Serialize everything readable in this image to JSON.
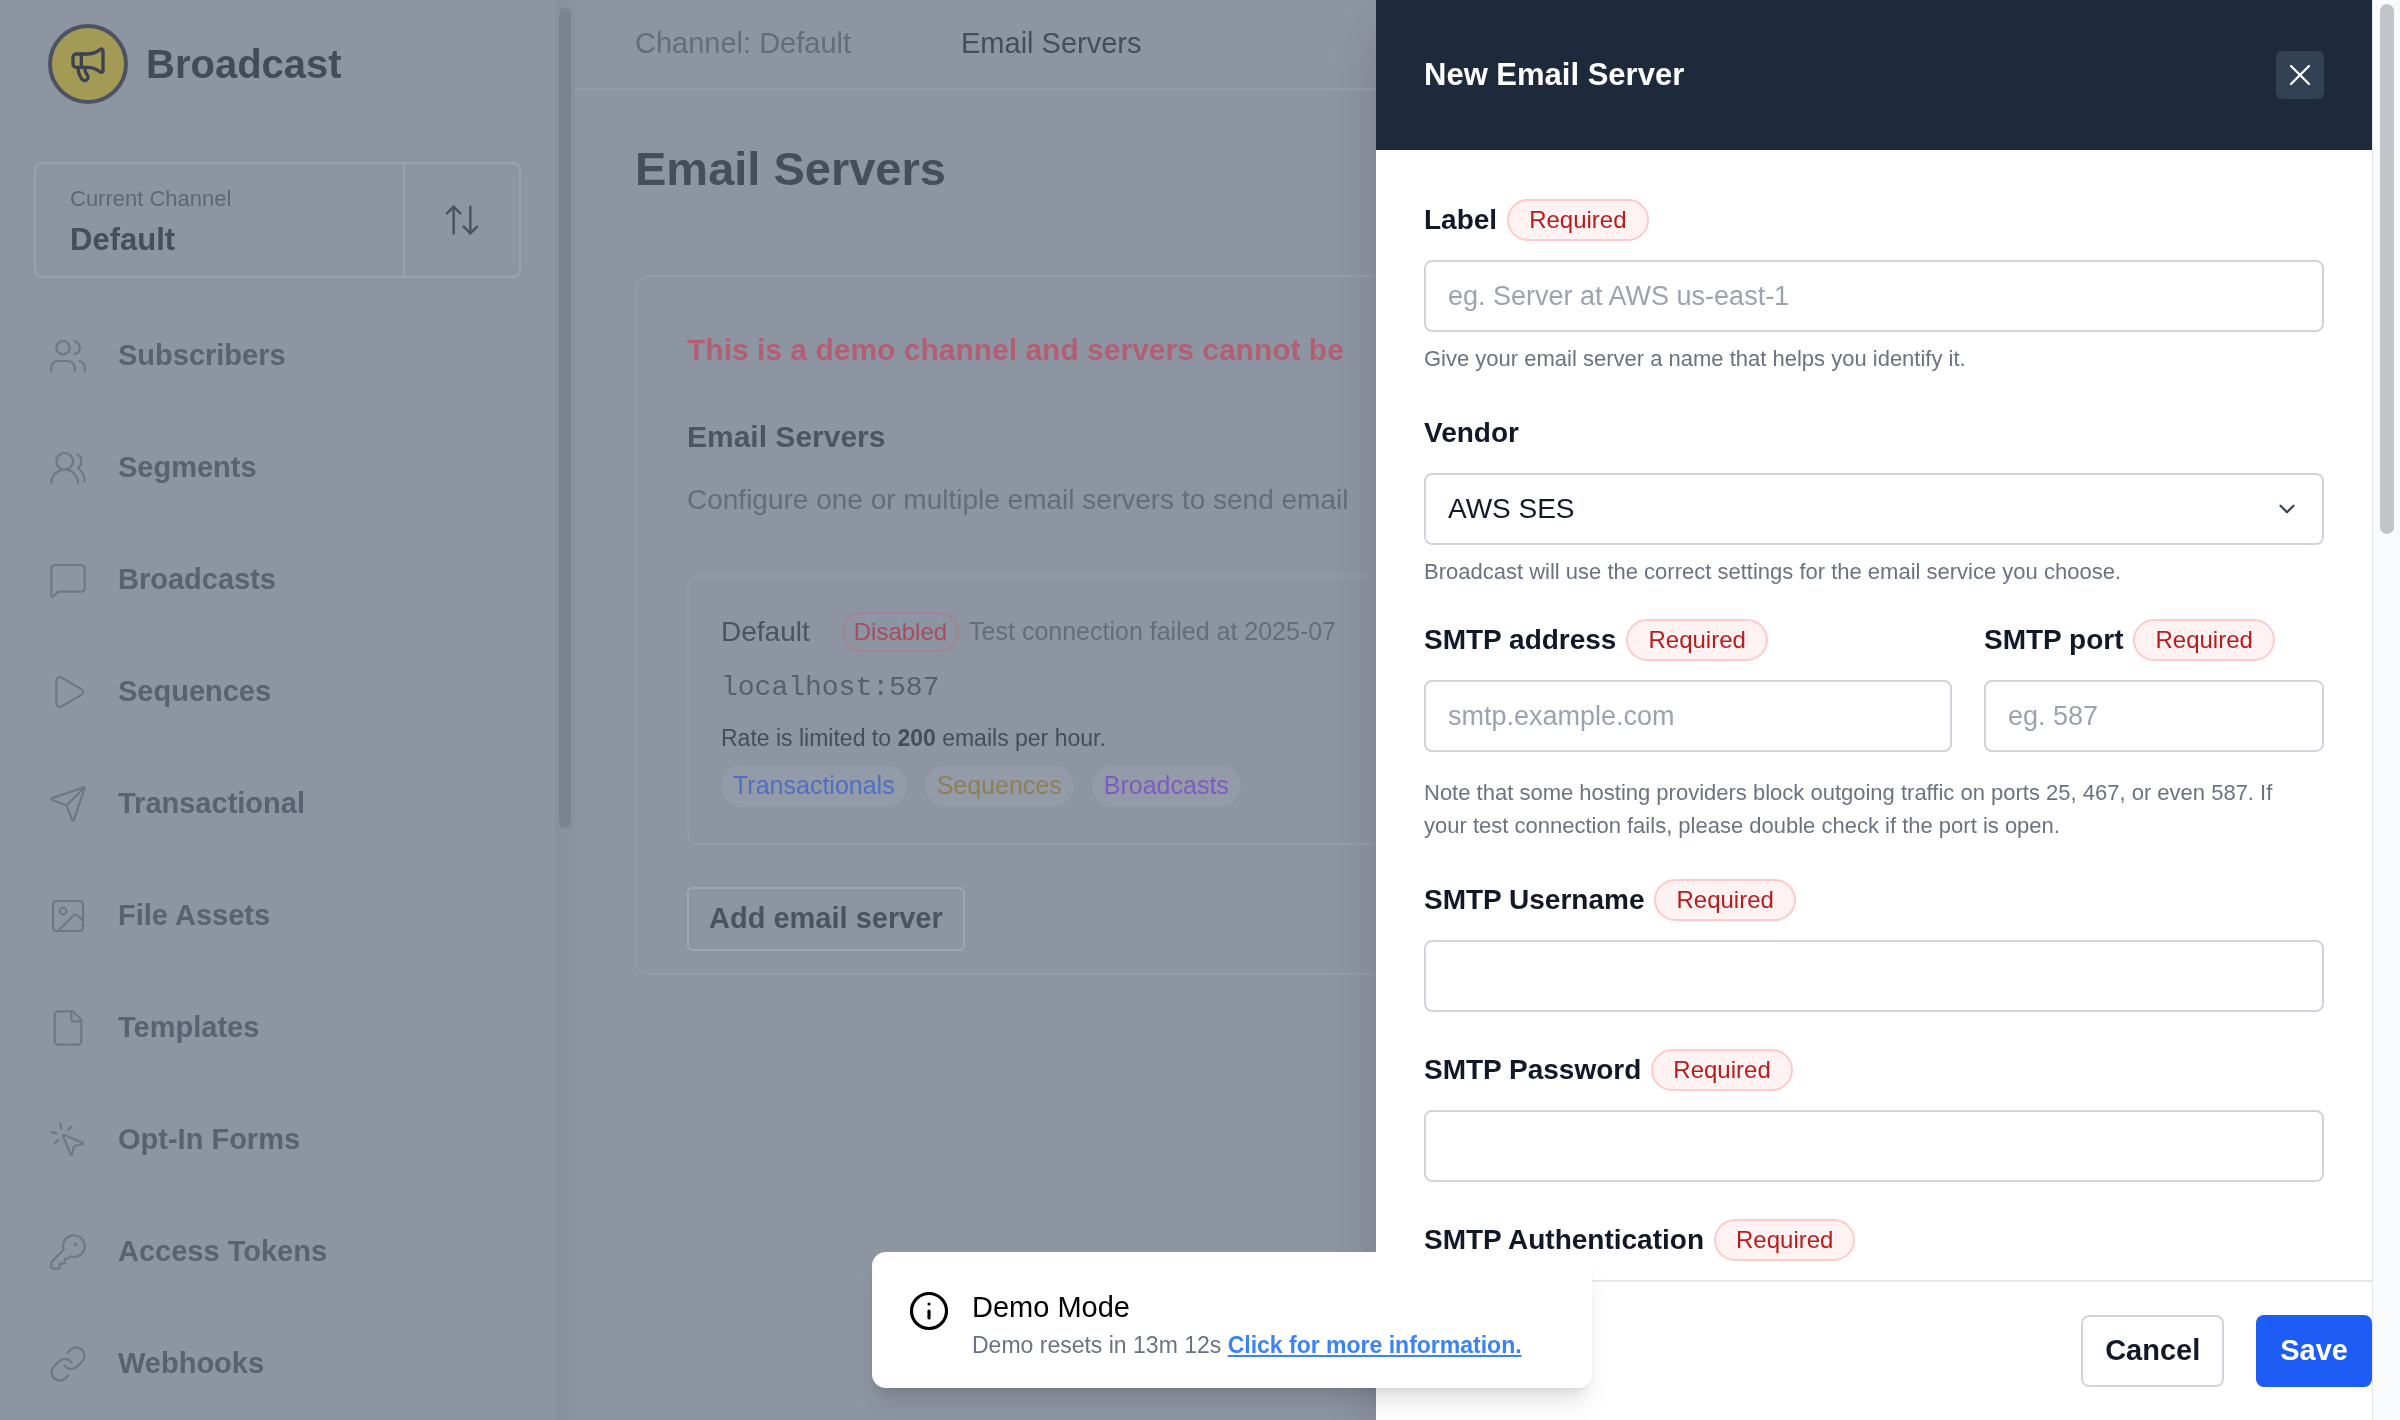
{
  "sidebar": {
    "brand": "Broadcast",
    "channel": {
      "label": "Current Channel",
      "value": "Default"
    },
    "items": [
      {
        "label": "Subscribers"
      },
      {
        "label": "Segments"
      },
      {
        "label": "Broadcasts"
      },
      {
        "label": "Sequences"
      },
      {
        "label": "Transactional"
      },
      {
        "label": "File Assets"
      },
      {
        "label": "Templates"
      },
      {
        "label": "Opt-In Forms"
      },
      {
        "label": "Access Tokens"
      },
      {
        "label": "Webhooks"
      }
    ]
  },
  "breadcrumbs": [
    {
      "label": "Channel: Default",
      "current": false
    },
    {
      "label": "Email Servers",
      "current": true
    }
  ],
  "main": {
    "title": "Email Servers",
    "warning": "This is a demo channel and servers cannot be",
    "section_title": "Email Servers",
    "description": "Configure one or multiple email servers to send email",
    "server": {
      "name": "Default",
      "status": "Disabled",
      "test": "Test connection failed at 2025-07",
      "host": "localhost:587",
      "rate": "Rate is limited to **200** emails per hour.",
      "tags": [
        {
          "label": "Transactionals",
          "color": "#4f6fc4"
        },
        {
          "label": "Sequences",
          "color": "#8f7f55"
        },
        {
          "label": "Broadcasts",
          "color": "#7d5cc0"
        }
      ]
    },
    "add_button": "Add email server"
  },
  "drawer": {
    "title": "New Email Server",
    "fields": [
      {
        "kind": "input",
        "label": "Label",
        "badge": "Required",
        "placeholder": "eg. Server at AWS us-east-1",
        "hint": "Give your email server a name that helps you identify it."
      },
      {
        "kind": "select",
        "label": "Vendor",
        "value": "AWS SES",
        "hint": "Broadcast will use the correct settings for the email service you choose."
      },
      {
        "kind": "pair",
        "items": [
          {
            "label": "SMTP address",
            "badge": "Required",
            "placeholder": "smtp.example.com"
          },
          {
            "label": "SMTP port",
            "badge": "Required",
            "placeholder": "eg. 587"
          }
        ],
        "hint": "Note that some hosting providers block outgoing traffic on ports 25, 467, or even 587. If your test connection fails, please double check if the port is open."
      },
      {
        "kind": "input",
        "label": "SMTP Username",
        "badge": "Required"
      },
      {
        "kind": "input",
        "label": "SMTP Password",
        "badge": "Required"
      },
      {
        "kind": "heading",
        "label": "SMTP Authentication",
        "badge": "Required"
      }
    ],
    "buttons": [
      {
        "label": "Cancel",
        "primary": false
      },
      {
        "label": "Save",
        "primary": true
      }
    ]
  },
  "toast": {
    "title": "Demo Mode",
    "text": "Demo resets in 13m 12s",
    "link": "Click for more information."
  }
}
